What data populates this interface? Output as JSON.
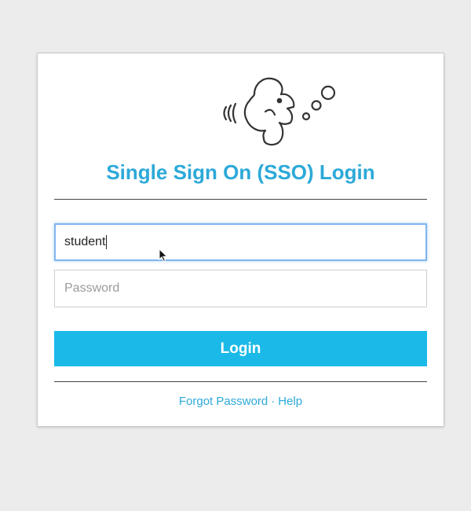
{
  "header": {
    "title": "Single Sign On (SSO) Login",
    "logo_icon": "fish-bubbles-logo-icon"
  },
  "form": {
    "username_value": "student",
    "password_placeholder": "Password",
    "login_label": "Login"
  },
  "footer": {
    "forgot_password_label": "Forgot Password",
    "separator": "·",
    "help_label": "Help"
  },
  "colors": {
    "accent": "#2ca9d8",
    "button": "#1ab9e8",
    "background": "#ececec",
    "focus_border": "#7fb5ee"
  }
}
